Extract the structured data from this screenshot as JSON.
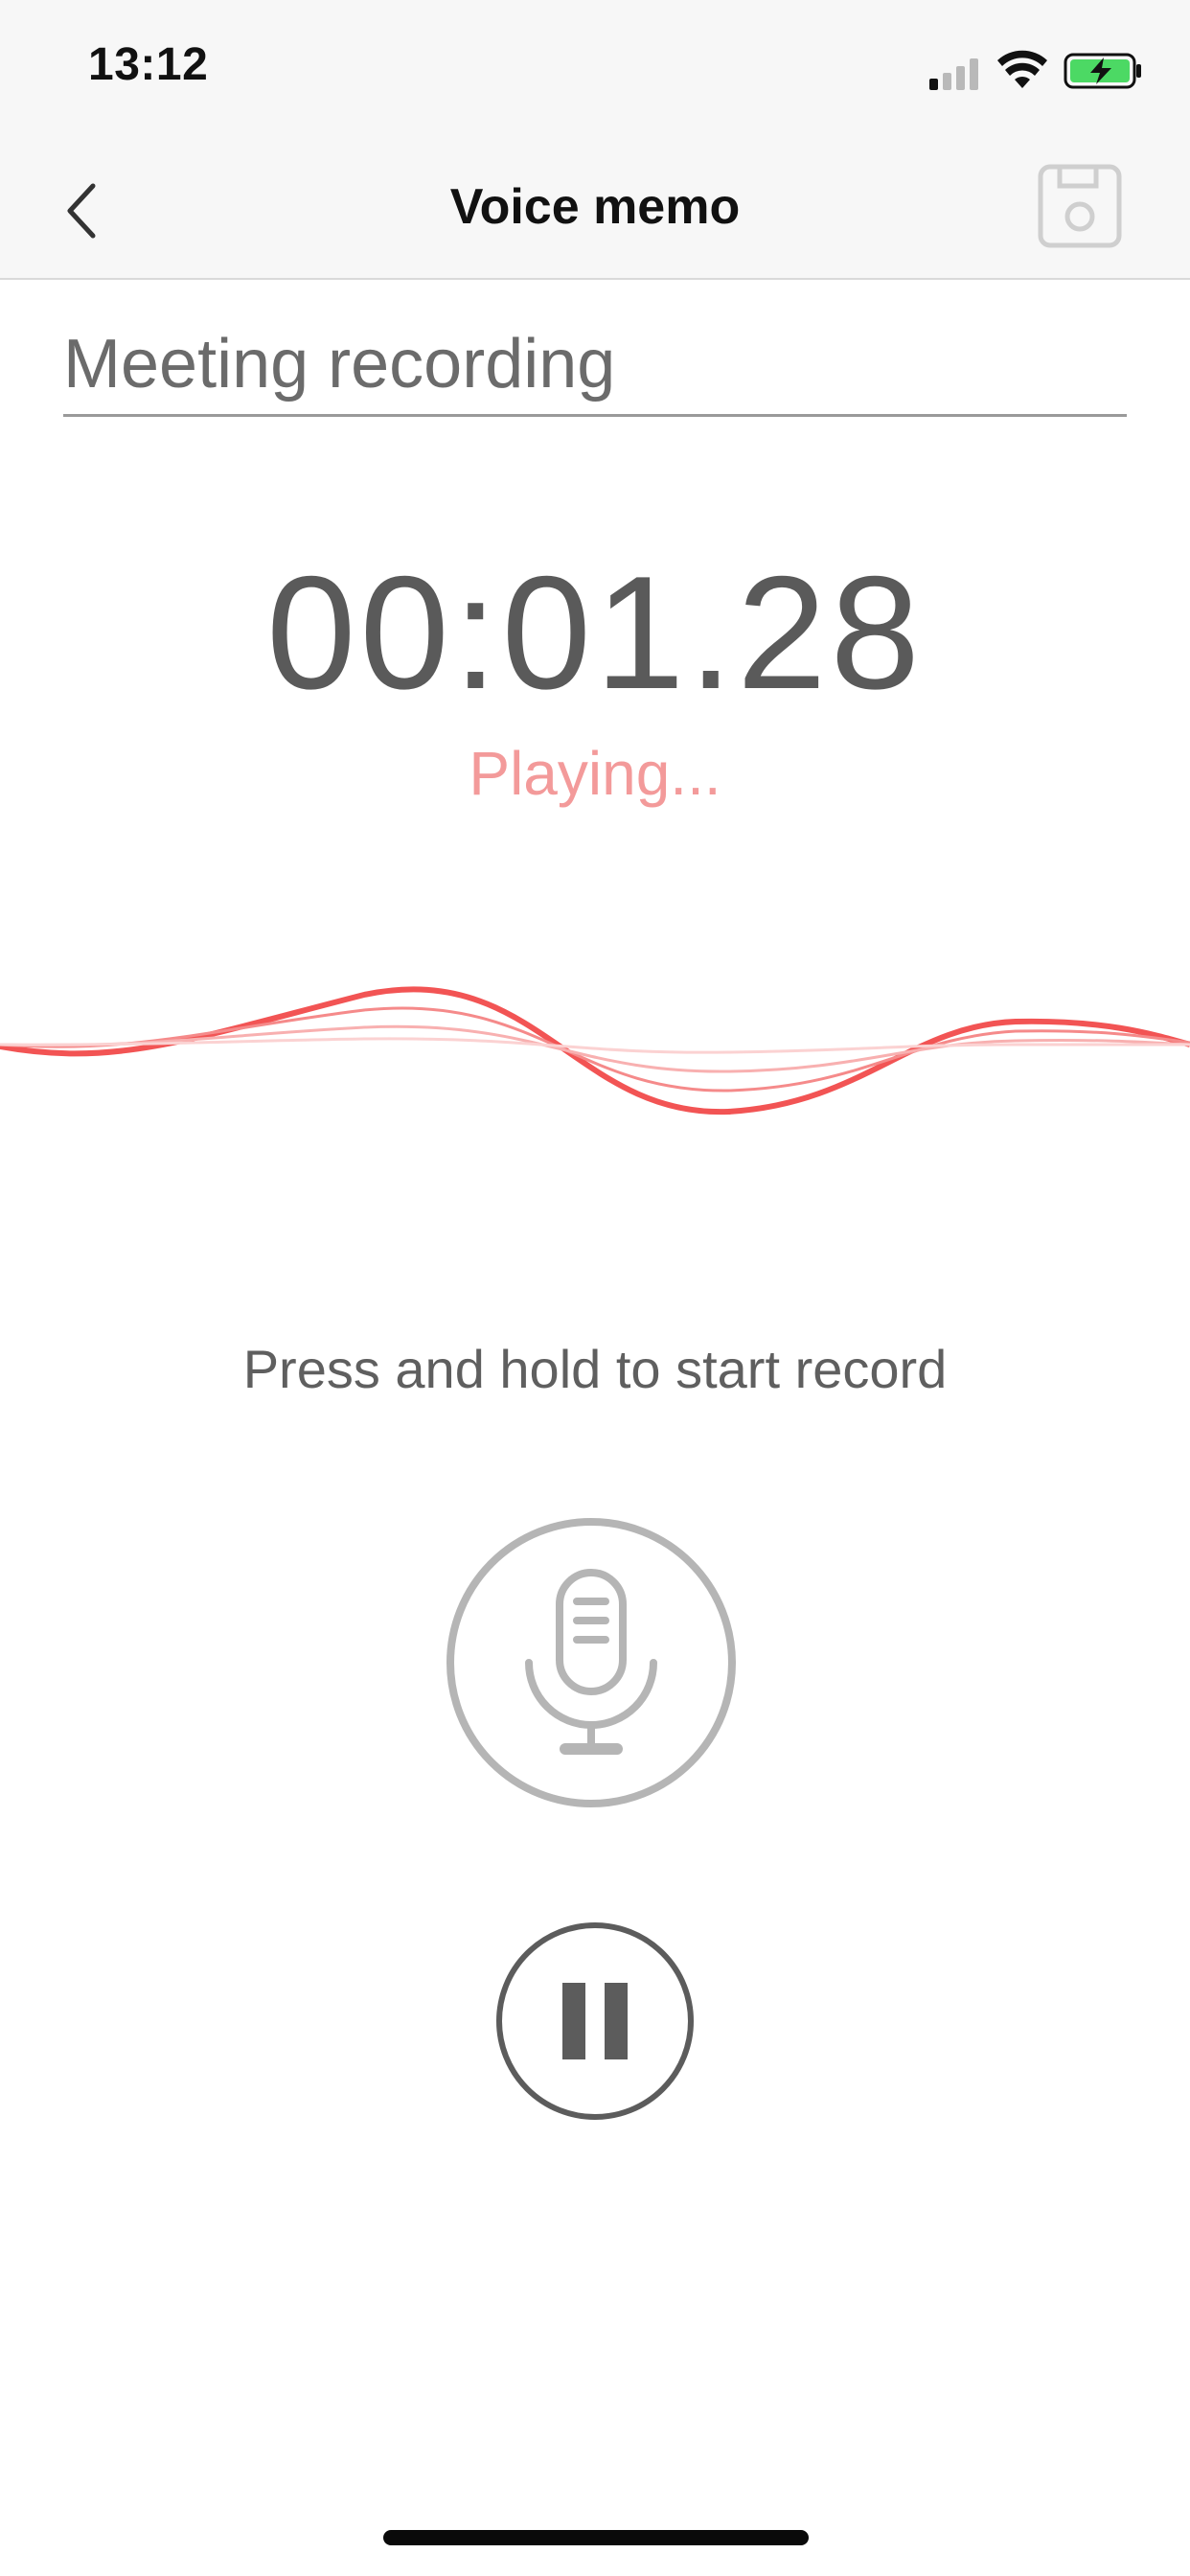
{
  "status_bar": {
    "time": "13:12"
  },
  "nav": {
    "title": "Voice memo",
    "back_icon": "chevron-left-icon",
    "save_icon": "floppy-disk-icon"
  },
  "memo": {
    "title_value": "Meeting recording"
  },
  "player": {
    "elapsed": "00:01.28",
    "status": "Playing..."
  },
  "hint": "Press and hold to start record",
  "controls": {
    "record_icon": "microphone-icon",
    "pause_icon": "pause-icon"
  },
  "colors": {
    "accent": "#f25454",
    "status_text": "#f39a9a",
    "battery_fill": "#4cd964"
  }
}
